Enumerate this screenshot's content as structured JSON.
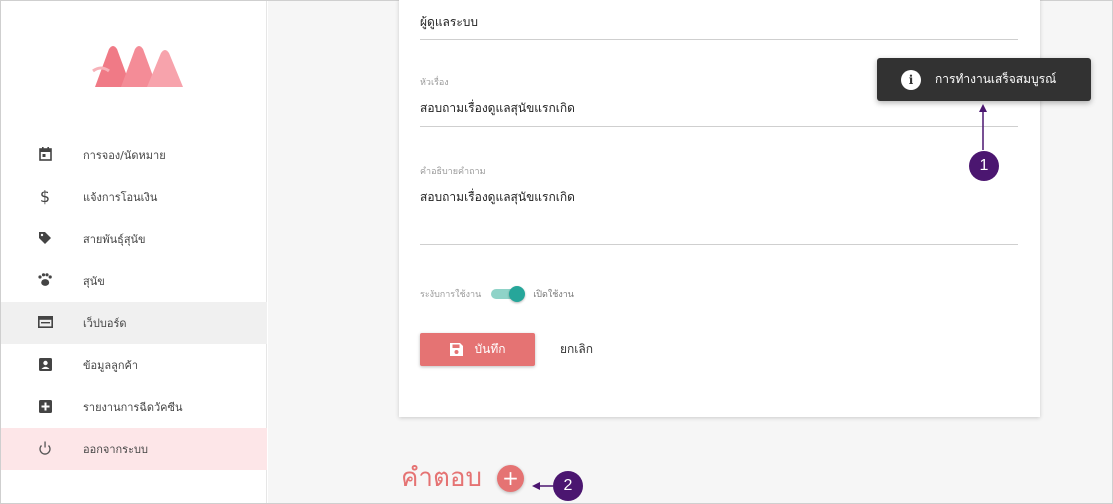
{
  "sidebar": {
    "items": [
      {
        "label": "การจอง/นัดหมาย",
        "icon": "calendar-icon"
      },
      {
        "label": "แจ้งการโอนเงิน",
        "icon": "dollar-icon"
      },
      {
        "label": "สายพันธุ์สุนัข",
        "icon": "tag-icon"
      },
      {
        "label": "สุนัข",
        "icon": "paw-icon"
      },
      {
        "label": "เว็ปบอร์ด",
        "icon": "webboard-icon"
      },
      {
        "label": "ข้อมูลลูกค้า",
        "icon": "contact-icon"
      },
      {
        "label": "รายงานการฉีดวัคซีน",
        "icon": "medical-plus-icon"
      },
      {
        "label": "ออกจากระบบ",
        "icon": "power-icon"
      }
    ]
  },
  "form": {
    "author_value": "ผู้ดูแลระบบ",
    "subject_label": "หัวเรื่อง",
    "subject_value": "สอบถามเรื่องดูแลสุนัขแรกเกิด",
    "description_label": "คำอธิบายคำถาม",
    "description_value": "สอบถามเรื่องดูแลสุนัขแรกเกิด",
    "toggle_off_label": "ระงับการใช้งาน",
    "toggle_on_label": "เปิดใช้งาน",
    "toggle_enabled": true,
    "save_label": "บันทึก",
    "cancel_label": "ยกเลิก"
  },
  "answers": {
    "title": "คำตอบ",
    "add_symbol": "+"
  },
  "toast": {
    "icon_glyph": "i",
    "message": "การทำงานเสร็จสมบูรณ์"
  },
  "annotations": {
    "badge_1": "1",
    "badge_2": "2",
    "color": "#4b1670"
  },
  "colors": {
    "accent": "#e57373",
    "switch": "#26a69a",
    "toast_bg": "#323232"
  }
}
